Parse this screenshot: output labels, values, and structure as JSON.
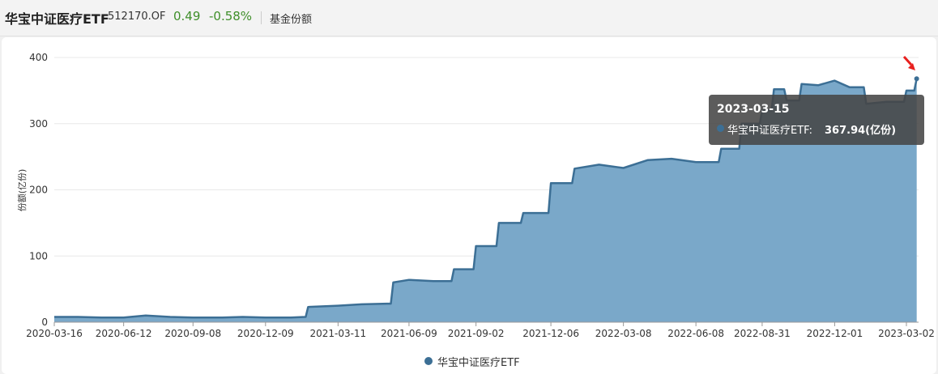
{
  "header": {
    "fund_name": "华宝中证医疗ETF",
    "code": "512170.OF",
    "price": "0.49",
    "change": "-0.58%",
    "metric_tab": "基金份额"
  },
  "tooltip": {
    "date": "2023-03-15",
    "series_label": "华宝中证医疗ETF:",
    "value": "367.94(亿份)"
  },
  "colors": {
    "area_fill": "#7aa8c9",
    "line": "#3c6f95",
    "marker_arrow": "#e8201e",
    "up_down_green": "#3f8f2a"
  },
  "chart_data": {
    "type": "area",
    "ylabel": "份额(亿份)",
    "xlabel": "",
    "ylim": [
      0,
      400
    ],
    "yticks": [
      0,
      100,
      200,
      300,
      400
    ],
    "xticks": [
      "2020-03-16",
      "2020-06-12",
      "2020-09-08",
      "2020-12-09",
      "2021-03-11",
      "2021-06-09",
      "2021-09-02",
      "2021-12-06",
      "2022-03-08",
      "2022-06-08",
      "2022-08-31",
      "2022-12-01",
      "2023-03-02"
    ],
    "grid": true,
    "legend_position": "bottom",
    "series": [
      {
        "name": "华宝中证医疗ETF",
        "x": [
          "2020-03-16",
          "2020-04-15",
          "2020-05-15",
          "2020-06-12",
          "2020-07-10",
          "2020-08-10",
          "2020-09-08",
          "2020-10-15",
          "2020-11-10",
          "2020-12-09",
          "2021-01-10",
          "2021-01-28",
          "2021-02-01",
          "2021-03-11",
          "2021-04-10",
          "2021-05-12",
          "2021-05-20",
          "2021-06-09",
          "2021-07-10",
          "2021-08-05",
          "2021-09-02",
          "2021-10-01",
          "2021-11-01",
          "2021-12-06",
          "2022-01-05",
          "2022-02-05",
          "2022-03-08",
          "2022-04-08",
          "2022-05-08",
          "2022-06-08",
          "2022-07-10",
          "2022-08-05",
          "2022-08-31",
          "2022-09-15",
          "2022-10-01",
          "2022-10-20",
          "2022-11-10",
          "2022-12-01",
          "2022-12-20",
          "2023-01-10",
          "2023-02-05",
          "2023-03-02",
          "2023-03-15"
        ],
        "values": [
          8,
          8,
          7,
          7,
          10,
          8,
          7,
          7,
          8,
          7,
          7,
          8,
          23,
          25,
          27,
          28,
          60,
          64,
          62,
          80,
          115,
          150,
          165,
          210,
          232,
          238,
          233,
          245,
          247,
          242,
          262,
          300,
          320,
          352,
          335,
          360,
          358,
          365,
          355,
          330,
          333,
          350,
          367.94
        ]
      }
    ]
  },
  "legend": {
    "label": "华宝中证医疗ETF"
  }
}
